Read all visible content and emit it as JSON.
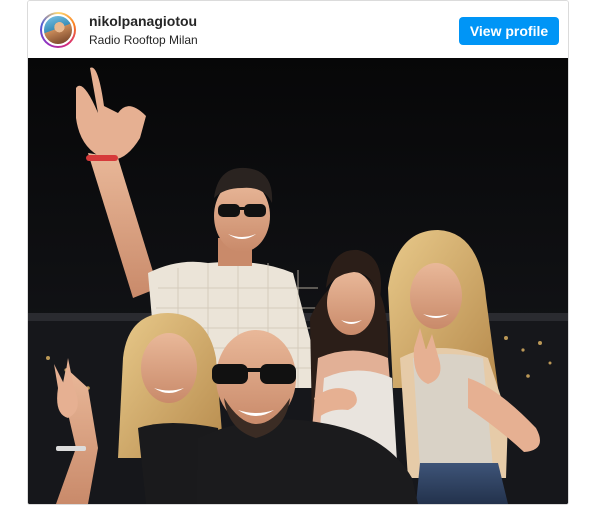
{
  "post": {
    "username": "nikolpanagiotou",
    "location": "Radio Rooftop Milan",
    "view_profile_label": "View profile",
    "avatar_icon": "profile-avatar",
    "photo_description_icon": "group-photo"
  },
  "colors": {
    "accent": "#0095f6",
    "text": "#262626",
    "border": "#dbdbdb"
  }
}
